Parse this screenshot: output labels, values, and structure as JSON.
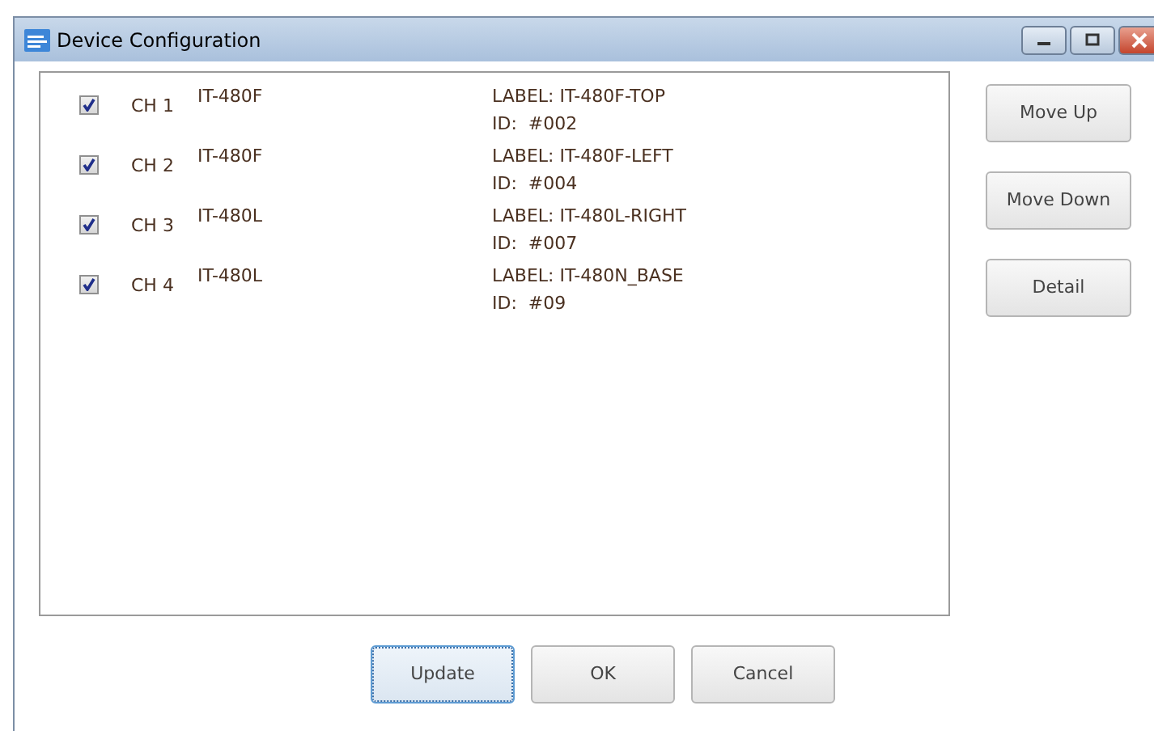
{
  "window": {
    "title": "Device Configuration"
  },
  "channels": [
    {
      "checked": true,
      "channel": "CH 1",
      "model": "IT-480F",
      "label": "LABEL: IT-480F-TOP",
      "id": "ID:  #002"
    },
    {
      "checked": true,
      "channel": "CH 2",
      "model": "IT-480F",
      "label": "LABEL: IT-480F-LEFT",
      "id": "ID:  #004"
    },
    {
      "checked": true,
      "channel": "CH 3",
      "model": "IT-480L",
      "label": "LABEL: IT-480L-RIGHT",
      "id": "ID:  #007"
    },
    {
      "checked": true,
      "channel": "CH 4",
      "model": "IT-480L",
      "label": "LABEL: IT-480N_BASE",
      "id": "ID:  #09"
    }
  ],
  "side_buttons": [
    "Move Up",
    "Move Down",
    "Detail"
  ],
  "bottom_buttons": [
    {
      "label": "Update",
      "focused": true
    },
    {
      "label": "OK",
      "focused": false
    },
    {
      "label": "Cancel",
      "focused": false
    }
  ]
}
